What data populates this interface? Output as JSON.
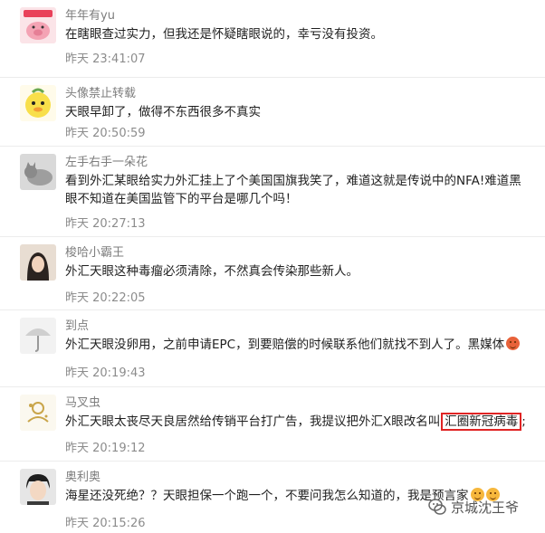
{
  "comments": [
    {
      "username": "年年有yu",
      "text": "在瞎眼查过实力，但我还是怀疑瞎眼说的，幸亏没有投资。",
      "time": "昨天 23:41:07"
    },
    {
      "username": "头像禁止转载",
      "text": "天眼早卸了，做得不东西很多不真实",
      "time": "昨天 20:50:59"
    },
    {
      "username": "左手右手一朵花",
      "text": "看到外汇某眼给实力外汇挂上了个美国国旗我笑了，难道这就是传说中的NFA!难道黑眼不知道在美国监管下的平台是哪几个吗！",
      "time": "昨天 20:27:13"
    },
    {
      "username": "梭哈小霸王",
      "text": "外汇天眼这种毒瘤必须清除，不然真会传染那些新人。",
      "time": "昨天 20:22:05"
    },
    {
      "username": "到点",
      "text": "外汇天眼没卵用，之前申请EPC，到要赔偿的时候联系他们就找不到人了。黑媒体",
      "time": "昨天 20:19:43"
    },
    {
      "username": "马叉虫",
      "text_before": "外汇天眼太丧尽天良居然给传销平台打广告，我提议把外汇X眼改名叫",
      "text_highlight": "汇圈新冠病毒",
      "text_after": ";",
      "time": "昨天 20:19:12"
    },
    {
      "username": "奥利奥",
      "text": "海星还没死绝？？天眼担保一个跑一个，不要问我怎么知道的，我是预言家",
      "time": "昨天 20:15:26"
    }
  ],
  "watermark": {
    "text": "京城沈王爷"
  }
}
